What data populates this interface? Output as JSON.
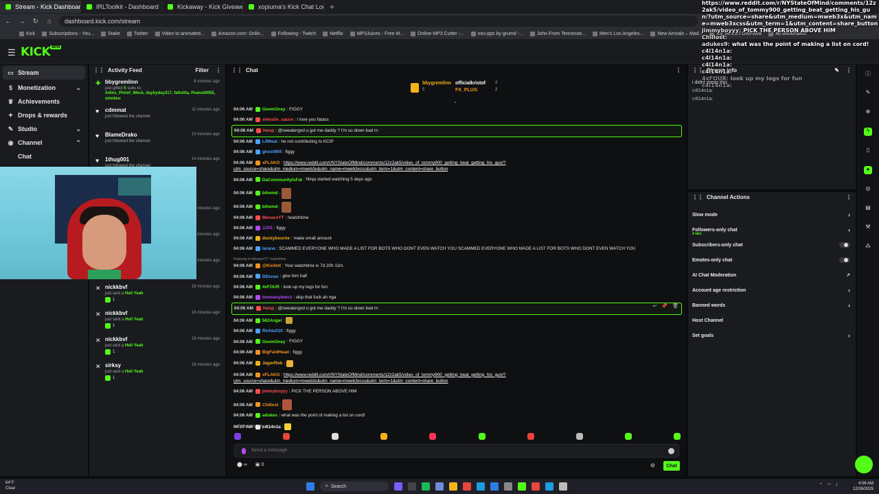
{
  "browser": {
    "tabs": [
      {
        "label": "Stream - Kick Dashboard",
        "active": true
      },
      {
        "label": "IRLToolkit - Dashboard"
      },
      {
        "label": "Kickaway - Kick Giveaway Tool"
      },
      {
        "label": "xopiuma's Kick Chat Logs in sw"
      }
    ],
    "url": "dashboard.kick.com/stream",
    "bookmarks": [
      "Kick",
      "Subscriptions - You...",
      "Stake",
      "Twitter",
      "Video to animated...",
      "Amazon.com: Onlin...",
      "Following - Twitch",
      "Netflix",
      "MP3Juices - Free M...",
      "Online MP3 Cutter -...",
      "osu-pps by grumd -...",
      "John From Tennesse...",
      "Men's Los Angeles...",
      "New Arrivals – Mad...",
      "My Verizon Overview",
      "All Bookmarks"
    ]
  },
  "kick": {
    "logo": "KICK",
    "beta": "BETA"
  },
  "sidebar": {
    "items": [
      {
        "label": "Stream",
        "icon": "stream-icon",
        "active": true
      },
      {
        "label": "Monetization",
        "icon": "dollar-icon",
        "chev": "⌄"
      },
      {
        "label": "Achievements",
        "icon": "trophy-icon"
      },
      {
        "label": "Drops & rewards",
        "icon": "gift-icon"
      },
      {
        "label": "Studio",
        "icon": "studio-icon",
        "chev": "⌄"
      },
      {
        "label": "Channel",
        "icon": "channel-icon",
        "chev": "⌃"
      }
    ],
    "sub": [
      "Chat"
    ]
  },
  "activity": {
    "title": "Activity Feed",
    "filter": "Filter",
    "items": [
      {
        "name": "bbygremlinn",
        "time": "8 minutes ago",
        "type": "gift",
        "desc_pre": "just gifted ",
        "desc_count": "5",
        "desc_post": " subs to:",
        "subs": "Adins_Pintof_Weck, daybyday317, fattolita, Peanut0055, smokeu"
      },
      {
        "name": "cdmmat",
        "time": "11 minutes ago",
        "type": "follow",
        "desc": "just followed the channel"
      },
      {
        "name": "BlameDrako",
        "time": "13 minutes ago",
        "type": "follow",
        "desc": "just followed the channel"
      },
      {
        "name": "1thug001",
        "time": "14 minutes ago",
        "type": "follow",
        "desc": "just followed the channel"
      },
      {
        "name": "",
        "time": "",
        "type": "follow",
        "desc": "just followed the channel"
      },
      {
        "name": "nickkbvf",
        "time": "18 minutes ago",
        "type": "kick",
        "desc_pre": "just sent a ",
        "desc_hl": "Hell Yeah",
        "badge": "1"
      },
      {
        "name": "nickkbvf",
        "time": "18 minutes ago",
        "type": "kick",
        "desc_pre": "just sent a ",
        "desc_hl": "Hell Yeah",
        "badge": "1"
      },
      {
        "name": "nickkbvf",
        "time": "18 minutes ago",
        "type": "kick",
        "desc_pre": "just sent a ",
        "desc_hl": "Hell Yeah",
        "badge": "1"
      },
      {
        "name": "nickkbvf",
        "time": "18 minutes ago",
        "type": "kick",
        "desc_pre": "just sent a ",
        "desc_hl": "Hell Yeah",
        "badge": "1"
      },
      {
        "name": "nickkbvf",
        "time": "18 minutes ago",
        "type": "kick",
        "desc_pre": "just sent a ",
        "desc_hl": "Hell Yeah",
        "badge": "1"
      },
      {
        "name": "nickkbvf",
        "time": "18 minutes ago",
        "type": "kick",
        "desc_pre": "just sent a ",
        "desc_hl": "Hell Yeah",
        "badge": "1"
      },
      {
        "name": "sirksy",
        "time": "18 minutes ago",
        "type": "kick",
        "desc_pre": "just sent a ",
        "desc_hl": "Hell Yeah",
        "badge": "1"
      }
    ]
  },
  "chat": {
    "title": "Chat",
    "pinned": {
      "a": "bbygremlinn",
      "a_count": "5",
      "b": "officialkristof",
      "b_count": "2",
      "c": "FX_PLUG",
      "c_count": "2"
    },
    "messages": [
      {
        "t": "04:06 AM",
        "u": "GeemOney",
        "c": "#53fc18",
        "text": "FIGGY"
      },
      {
        "t": "04:06 AM",
        "u": "shiestie_sauce",
        "c": "#ff4d4d",
        "text": "i love you fatass"
      },
      {
        "t": "04:06 AM",
        "u": "hwsp",
        "c": "#ff4d4d",
        "text": "@sweatergxd u got me daddy ? I'm so down bad rn",
        "hl": true
      },
      {
        "t": "04:06 AM",
        "u": "LilMeat",
        "c": "#4da3ff",
        "text": "he not contributing to KCIP"
      },
      {
        "t": "04:06 AM",
        "u": "ghost909",
        "c": "#4da3ff",
        "text": "figgy"
      },
      {
        "t": "04:06 AM",
        "u": "xFLAKO",
        "c": "#f7931e",
        "link": "https://www.reddit.com/r/NYStateOfMind/comments/12z2ak5/video_of_tommy900_getting_beat_getting_his_gun/?",
        "link2": "utm_source=share&utm_medium=mweb3x&utm_name=mweb3xcss&utm_term=1&utm_content=share_button",
        "wrap": true
      },
      {
        "t": "04:06 AM",
        "u": "DaCommunityIsFat",
        "c": "#53fc18",
        "text": "Ninja started watching 5 days ago"
      },
      {
        "t": "04:06 AM",
        "u": "bihemd",
        "c": "#53fc18",
        "emote": "#9a5a3a",
        "tall": true
      },
      {
        "t": "04:06 AM",
        "u": "bihemd",
        "c": "#53fc18",
        "emote": "#9a5a3a",
        "tall": true
      },
      {
        "t": "04:06 AM",
        "u": "MenaceYT",
        "c": "#ff4d4d",
        "text": "!watchtime"
      },
      {
        "t": "04:06 AM",
        "u": "JJX5",
        "c": "#b24bf3",
        "text": "figgy"
      },
      {
        "t": "04:06 AM",
        "u": "duckybourne",
        "c": "#f2b21a",
        "text": "make small amount"
      },
      {
        "t": "04:06 AM",
        "u": "larana",
        "c": "#4da3ff",
        "text": "SCAMMED EVERYONE WHO MADE A LIST FOR BOTS WHO DONT EVEN WATCH YOU    SCAMMED EVERYONE WHO MADE A LIST FOR BOTS WHO DONT EVEN WATCH YOU"
      },
      {
        "t": "04:06 AM",
        "u": "@Kicklet",
        "c": "#f7931e",
        "reply": "Replying to MenaceYT: !watchtime",
        "text": "Your watchtime is 7d 20h 11m.",
        "wrap": true
      },
      {
        "t": "04:06 AM",
        "u": "DDsnax",
        "c": "#4da3ff",
        "text": "give him half"
      },
      {
        "t": "04:06 AM",
        "u": "4xFOUR",
        "c": "#53fc18",
        "text": "look up my logs for fun"
      },
      {
        "t": "04:06 AM",
        "u": "toomanybeerz",
        "c": "#b24bf3",
        "text": "skip that fuck ah nga"
      },
      {
        "t": "04:06 AM",
        "u": "hwsp",
        "c": "#ff4d4d",
        "text": "@sweatergxd u got me daddy ? I'm so down bad rn",
        "hl": true,
        "tools": true
      },
      {
        "t": "04:06 AM",
        "u": "562Angel",
        "c": "#53fc18",
        "emote": "#c9a23a"
      },
      {
        "t": "04:06 AM",
        "u": "Richie310",
        "c": "#4da3ff",
        "text": "figgy"
      },
      {
        "t": "04:06 AM",
        "u": "GeemOney",
        "c": "#53fc18",
        "text": "FIGGY"
      },
      {
        "t": "04:06 AM",
        "u": "BigFat4Head",
        "c": "#f7931e",
        "text": "figgy"
      },
      {
        "t": "04:06 AM",
        "u": "JagerRob",
        "c": "#f2b21a",
        "emote": "#e8b23a"
      },
      {
        "t": "04:06 AM",
        "u": "xFLAKO",
        "c": "#f7931e",
        "link": "https://www.reddit.com/r/NYStateOfMind/comments/12z2ak5/video_of_tommy900_getting_beat_getting_his_gun/?",
        "link2": "utm_source=share&utm_medium=mweb3x&utm_name=mweb3xcss&utm_term=1&utm_content=share_button",
        "wrap": true
      },
      {
        "t": "04:06 AM",
        "u": "jimmyboyyy",
        "c": "#ff4d4d",
        "text": "PICK THE PERSON ABOVE HIM"
      },
      {
        "t": "04:06 AM",
        "u": "Chillost",
        "c": "#f7931e",
        "emote": "#b0553a",
        "tall": true
      },
      {
        "t": "04:06 AM",
        "u": "adukes",
        "c": "#53fc18",
        "text": "what was the point of making a list on cord!"
      },
      {
        "t": "04:07 AM",
        "u": "c4l14n1a",
        "c": "#ffffff",
        "emote": "#f2d13a"
      }
    ],
    "followers_only": "Followers only",
    "placeholder": "Send a message",
    "viewers_label": "∞",
    "count": "0",
    "send_label": "Chat"
  },
  "stream_info": {
    "title": "Stream info",
    "lines": [
      "i didnt mean this",
      "c4l14n1a:",
      "c4l14n1a:"
    ]
  },
  "channel_actions": {
    "title": "Channel Actions",
    "rows": [
      {
        "label": "Slow mode",
        "kind": "arrow"
      },
      {
        "label": "Followers-only chat",
        "sub": "4 wks",
        "kind": "arrow"
      },
      {
        "label": "Subscribers-only chat",
        "kind": "toggle"
      },
      {
        "label": "Emotes-only chat",
        "kind": "toggle"
      },
      {
        "label": "AI Chat Moderation",
        "kind": "ext"
      },
      {
        "label": "Account age restriction",
        "kind": "arrow"
      },
      {
        "label": "Banned words",
        "kind": "arrow"
      },
      {
        "label": "Host Channel",
        "kind": "none"
      },
      {
        "label": "Set goals",
        "kind": "arrow"
      }
    ]
  },
  "overlay": {
    "lines": [
      {
        "n": "",
        "text": "https://www.reddit.com/r/NYStateOfMind/comments/12z2ak5/video_of_tommy900_getting_beat_getting_his_gun/?utm_source=share&utm_medium=mweb3x&utm_name=mweb3xcss&utm_term=1&utm_content=share_button"
      },
      {
        "n": "jimmyboyyy:",
        "text": "PICK THE PERSON ABOVE HIM",
        "red": true
      },
      {
        "n": "Chillost:",
        "text": ""
      },
      {
        "n": "adukes9:",
        "text": "what was the point of making a list on cord!",
        "red": true
      },
      {
        "n": "c4l14n1a:",
        "text": ""
      },
      {
        "n": "c4l14n1a:",
        "text": ""
      },
      {
        "n": "c4l14n1a:",
        "text": ""
      },
      {
        "n": "c4l14n1a:",
        "text": ""
      },
      {
        "n": "4xFOUR:",
        "text": "look up my logs for fun",
        "dim": true
      },
      {
        "n": "c4l14n1a:",
        "text": "",
        "dim": true
      }
    ]
  },
  "taskbar": {
    "temp": "64°F",
    "cond": "Clear",
    "search": "Search",
    "time": "4:06 AM",
    "date": "12/26/2025"
  }
}
